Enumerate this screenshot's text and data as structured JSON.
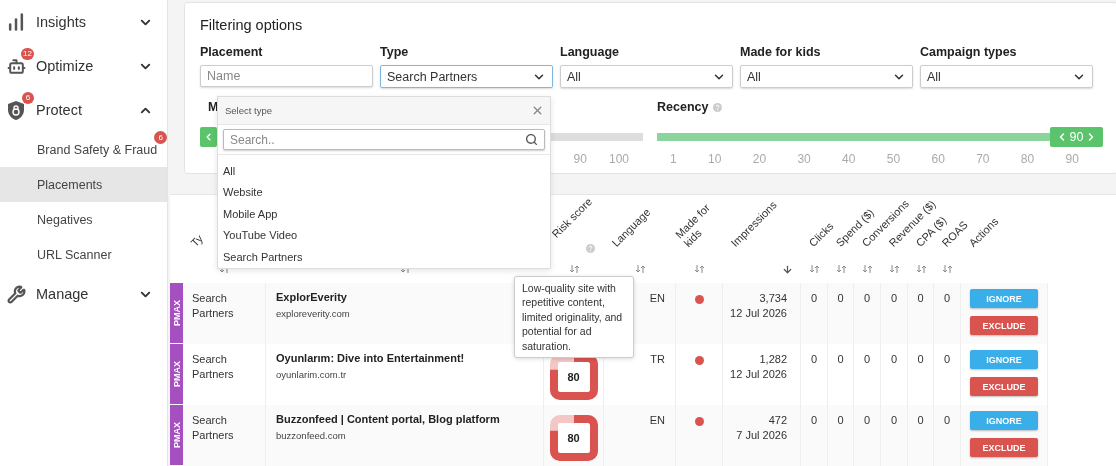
{
  "sidebar": {
    "items": [
      {
        "label": "Insights",
        "expanded": false
      },
      {
        "label": "Optimize",
        "badge": "12",
        "expanded": false
      },
      {
        "label": "Protect",
        "badge": "6",
        "expanded": true,
        "children": [
          {
            "label": "Brand Safety & Fraud",
            "badge": "6",
            "selected": false
          },
          {
            "label": "Placements",
            "selected": true
          },
          {
            "label": "Negatives",
            "selected": false
          },
          {
            "label": "URL Scanner",
            "selected": false
          }
        ]
      },
      {
        "label": "Manage",
        "expanded": false
      }
    ]
  },
  "filters": {
    "title": "Filtering options",
    "fields": [
      {
        "kind": "input",
        "label": "Placement",
        "placeholder": "Name"
      },
      {
        "kind": "select",
        "label": "Type",
        "value": "Search Partners",
        "open": true
      },
      {
        "kind": "select",
        "label": "Language",
        "value": "All",
        "open": false
      },
      {
        "kind": "select",
        "label": "Made for kids",
        "value": "All",
        "open": false
      },
      {
        "kind": "select",
        "label": "Campaign types",
        "value": "All",
        "open": false
      }
    ],
    "sliders": [
      {
        "label": "M",
        "ticks": [
          "90",
          "100"
        ]
      },
      {
        "label": "Recency",
        "help": true,
        "level": 1,
        "value": "90",
        "ticks": [
          "1",
          "10",
          "20",
          "30",
          "40",
          "50",
          "60",
          "70",
          "80",
          "90"
        ]
      }
    ]
  },
  "type_dropdown": {
    "title": "Select type",
    "search_placeholder": "Search..",
    "options": [
      "All",
      "Website",
      "Mobile App",
      "YouTube Video",
      "Search Partners"
    ]
  },
  "table": {
    "columns": [
      {
        "label": "Ty",
        "sortable": true,
        "sorted": false
      },
      {
        "sortable": true,
        "sorted": false
      },
      {
        "label": "Risk score",
        "help": true,
        "sortable": true,
        "sorted": false
      },
      {
        "label": "Language",
        "sortable": true,
        "sorted": false
      },
      {
        "label": "Made for kids",
        "sortable": true,
        "sorted": false
      },
      {
        "label": "Impressions",
        "sortable": true,
        "sorted": true
      },
      {
        "label": "Clicks",
        "sortable": true,
        "sorted": false
      },
      {
        "label": "Spend ($)",
        "sortable": true,
        "sorted": false
      },
      {
        "label": "Conversions",
        "sortable": true,
        "sorted": false
      },
      {
        "label": "Revenue ($)",
        "sortable": true,
        "sorted": false
      },
      {
        "label": "CPA ($)",
        "sortable": true,
        "sorted": false
      },
      {
        "label": "ROAS",
        "sortable": true,
        "sorted": false
      },
      {
        "label": "Actions"
      }
    ],
    "rows": [
      {
        "campaign": "PMAX",
        "type": "Search Partners",
        "name": "ExplorEverity",
        "domain": "exploreverity.com",
        "tooltip": "Low-quality site with repetitive content, limited originality, and potential for ad saturation.",
        "language": "EN",
        "made_for_kids": false,
        "impressions": "3,734",
        "date": "12 Jul 2026",
        "metrics": [
          "0",
          "0",
          "0",
          "0",
          "0",
          "0"
        ],
        "actions": [
          "IGNORE",
          "EXCLUDE"
        ]
      },
      {
        "campaign": "PMAX",
        "type": "Search Partners",
        "name": "Oyunlarım: Dive into Entertainment!",
        "domain": "oyunlarim.com.tr",
        "risk": {
          "score": "80",
          "level": 0.8
        },
        "language": "TR",
        "made_for_kids": false,
        "impressions": "1,282",
        "date": "12 Jul 2026",
        "metrics": [
          "0",
          "0",
          "0",
          "0",
          "0",
          "0"
        ],
        "actions": [
          "IGNORE",
          "EXCLUDE"
        ]
      },
      {
        "campaign": "PMAX",
        "type": "Search Partners",
        "name": "Buzzonfeed | Content portal, Blog platform",
        "domain": "buzzonfeed.com",
        "risk": {
          "score": "80",
          "level": 0.8
        },
        "language": "EN",
        "made_for_kids": false,
        "impressions": "472",
        "date": "7 Jul 2026",
        "metrics": [
          "0",
          "0",
          "0",
          "0",
          "0",
          "0"
        ],
        "actions": [
          "IGNORE",
          "EXCLUDE"
        ]
      }
    ]
  }
}
